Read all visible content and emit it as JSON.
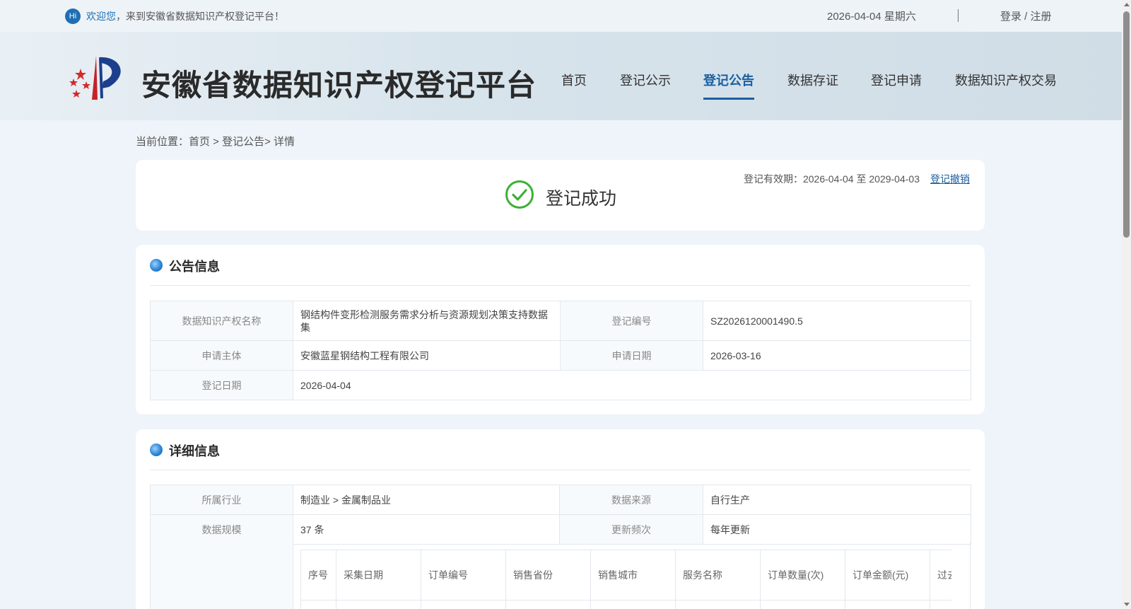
{
  "topbar": {
    "hi_badge": "Hi",
    "welcome_accent": "欢迎您",
    "welcome_rest": "，来到安徽省数据知识产权登记平台！",
    "date": "2026-04-04 星期六",
    "login": "登录 / 注册"
  },
  "header": {
    "site_title": "安徽省数据知识产权登记平台",
    "nav": [
      "首页",
      "登记公示",
      "登记公告",
      "数据存证",
      "登记申请",
      "数据知识产权交易"
    ],
    "active_nav": "登记公告"
  },
  "breadcrumb": "当前位置：首页 > 登记公告> 详情",
  "status": {
    "text": "登记成功",
    "validity": "登记有效期：2026-04-04 至 2029-04-03",
    "revoke": "登记撤销",
    "success_color": "#3cb034"
  },
  "announcement": {
    "title": "公告信息",
    "name_label": "数据知识产权名称",
    "name_value": "钢结构件变形检测服务需求分析与资源规划决策支持数据集",
    "reg_no_label": "登记编号",
    "reg_no_value": "SZ2026120001490.5",
    "applicant_label": "申请主体",
    "applicant_value": "安徽蓝星钢结构工程有限公司",
    "apply_date_label": "申请日期",
    "apply_date_value": "2026-03-16",
    "reg_date_label": "登记日期",
    "reg_date_value": "2026-04-04"
  },
  "details": {
    "title": "详细信息",
    "industry_label": "所属行业",
    "industry_value": "制造业 > 金属制品业",
    "source_label": "数据来源",
    "source_value": "自行生产",
    "scale_label": "数据规模",
    "scale_value": "37 条",
    "freq_label": "更新频次",
    "freq_value": "每年更新",
    "columns": [
      "序号",
      "采集日期",
      "订单编号",
      "销售省份",
      "销售城市",
      "服务名称",
      "订单数量(次)",
      "订单金额(元)",
      "过去需求量"
    ]
  },
  "colors": {
    "accent": "#1a5fa0",
    "page_bg": "#eef4f9"
  }
}
